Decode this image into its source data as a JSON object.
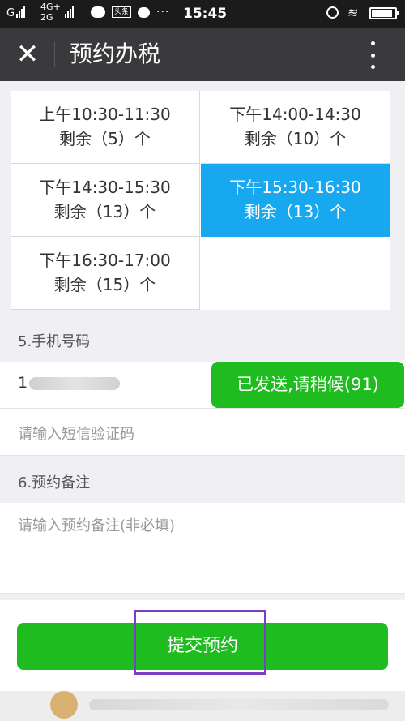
{
  "status": {
    "signal1": "G",
    "network_top": "4G+",
    "network_bottom": "2G",
    "news_badge": "头条",
    "more": "···",
    "time": "15:45",
    "wifi": "≋"
  },
  "battery_level": 0.9,
  "titlebar": {
    "close_glyph": "✕",
    "title": "预约办税"
  },
  "slots": [
    {
      "time": "上午10:30-11:30",
      "remain": "剩余（5）个",
      "selected": false
    },
    {
      "time": "下午14:00-14:30",
      "remain": "剩余（10）个",
      "selected": false
    },
    {
      "time": "下午14:30-15:30",
      "remain": "剩余（13）个",
      "selected": false
    },
    {
      "time": "下午15:30-16:30",
      "remain": "剩余（13）个",
      "selected": true
    },
    {
      "time": "下午16:30-17:00",
      "remain": "剩余（15）个",
      "selected": false
    }
  ],
  "phone_section": {
    "label": "5.手机号码",
    "phone_prefix": "1",
    "send_button": "已发送,请稍候(91)",
    "sms_placeholder": "请输入短信验证码"
  },
  "note_section": {
    "label": "6.预约备注",
    "note_placeholder": "请输入预约备注(非必填)"
  },
  "submit_label": "提交预约",
  "colors": {
    "accent_blue": "#18a8f0",
    "button_green": "#1ebc1e",
    "highlight_purple": "#7b3fc6"
  }
}
